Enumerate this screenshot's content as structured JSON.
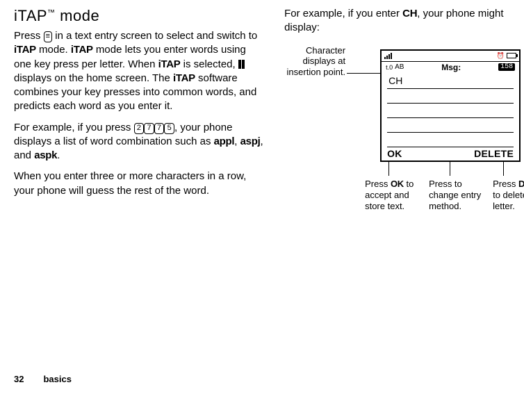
{
  "footer": {
    "page_number": "32",
    "section": "basics"
  },
  "left": {
    "heading": "iTAP",
    "heading_suffix": " mode",
    "tm": "™",
    "p1_a": "Press ",
    "p1_menu_glyph": "≡",
    "p1_b": " in a text entry screen to select and switch to ",
    "p1_itap1": "iTAP",
    "p1_c": " mode. ",
    "p1_itap2": "iTAP",
    "p1_d": " mode lets you enter words using one key press per letter. When ",
    "p1_itap3": "iTAP",
    "p1_e": " is selected, ",
    "p1_f": " displays on the home screen. The ",
    "p1_itap4": "iTAP",
    "p1_g": " software combines your key presses into common words, and predicts each word as you enter it.",
    "p2_a": "For example, if you press ",
    "key_2": "2",
    "key_7a": "7",
    "key_7b": "7",
    "key_5": "5",
    "p2_b": ", your phone displays a list of word combination such as ",
    "p2_w1": "appl",
    "p2_c1": ", ",
    "p2_w2": "aspj",
    "p2_c2": ", and ",
    "p2_w3": "aspk",
    "p2_c3": ".",
    "p3": "When you enter three or more characters in a row, your phone will guess the rest of the word."
  },
  "right": {
    "p1_a": "For example, if you enter ",
    "p1_entry": "CH",
    "p1_b": ", your phone might display:",
    "side_label": "Character displays at insertion point.",
    "screen": {
      "mode": "AB",
      "reception_label": "t.0",
      "title": "Msg:",
      "counter": "158",
      "entered": "CH",
      "soft_left": "OK",
      "soft_right": "DELETE"
    },
    "annot1_a": "Press ",
    "annot1_key": "OK",
    "annot1_b": " to accept and store text.",
    "annot2": "Press to change entry method.",
    "annot3_a": "Press ",
    "annot3_key": "DELETE",
    "annot3_b": " to delete the letter."
  }
}
